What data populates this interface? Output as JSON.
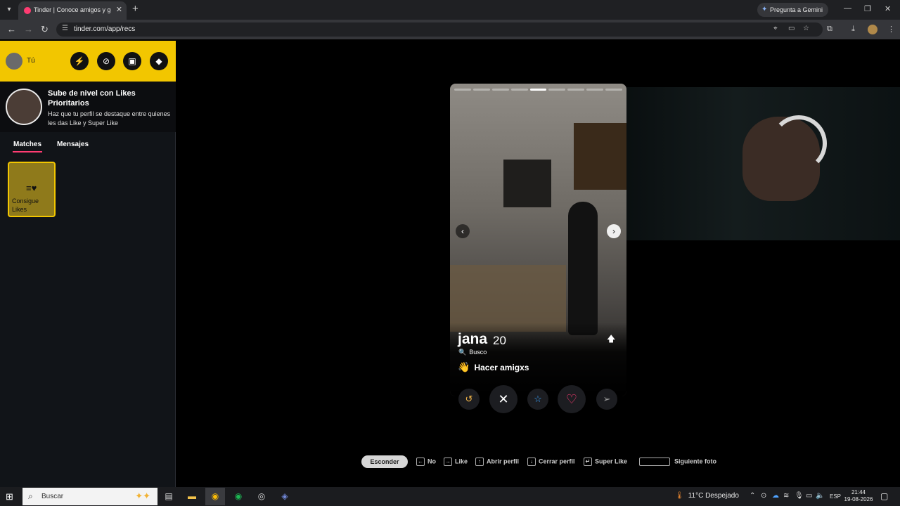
{
  "browser": {
    "tab_title": "Tinder | Conoce amigos y gente",
    "gemini_label": "Pregunta a Gemini",
    "url": "tinder.com/app/recs"
  },
  "sidebar": {
    "me_label": "Tú",
    "promo_title": "Sube de nivel con Likes Prioritarios",
    "promo_text": "Haz que tu perfil se destaque entre quienes les das Like y Super Like",
    "tabs": [
      {
        "label": "Matches",
        "active": true
      },
      {
        "label": "Mensajes",
        "active": false
      }
    ],
    "likes_card_label": "Consigue Likes"
  },
  "profile": {
    "name": "jana",
    "age": "20",
    "busco_label": "Busco",
    "intent": "Hacer amigxs",
    "photo_count": 9,
    "active_photo_index": 4
  },
  "actions": {
    "rewind_icon": "rewind-icon",
    "nope_icon": "close-icon",
    "superlike_icon": "star-icon",
    "like_icon": "heart-icon",
    "boost_icon": "send-icon",
    "like_color": "#fe3c72"
  },
  "shortcuts": {
    "hide_label": "Esconder",
    "items": [
      {
        "key": "←",
        "label": "No"
      },
      {
        "key": "→",
        "label": "Like"
      },
      {
        "key": "↑",
        "label": "Abrir perfil"
      },
      {
        "key": "↓",
        "label": "Cerrar perfil"
      },
      {
        "key": "↵",
        "label": "Super Like"
      },
      {
        "key": "space",
        "label": "Siguiente foto"
      }
    ]
  },
  "taskbar": {
    "search_placeholder": "Buscar",
    "weather": "11°C  Despejado",
    "language": "ESP",
    "time": "21:44",
    "date": "19-08-2026"
  },
  "colors": {
    "brand_yellow": "#f2c600",
    "tinder_pink": "#fe3c72"
  }
}
